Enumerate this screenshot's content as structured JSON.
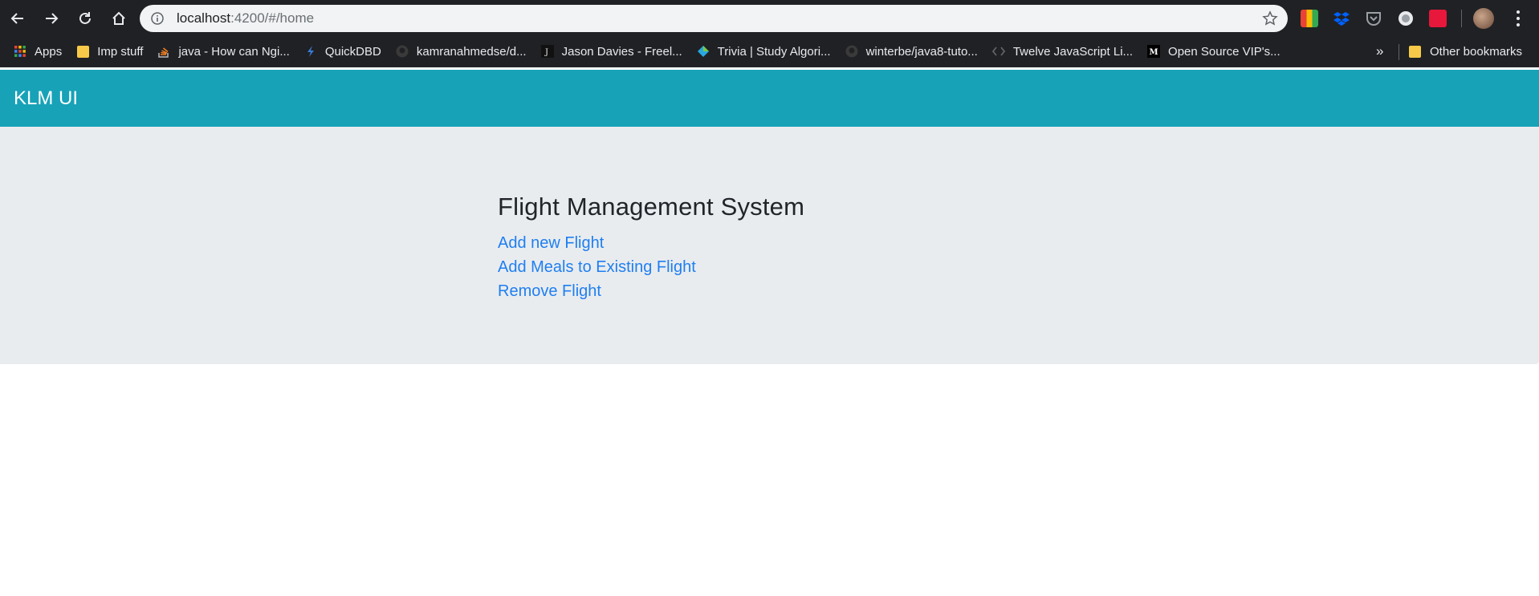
{
  "browser": {
    "url_host": "localhost",
    "url_path": ":4200/#/home"
  },
  "bookmarks": [
    {
      "label": "Apps",
      "icon": "apps-grid-icon"
    },
    {
      "label": "Imp stuff",
      "icon": "folder-icon"
    },
    {
      "label": "java - How can Ngi...",
      "icon": "stackoverflow-icon"
    },
    {
      "label": "QuickDBD",
      "icon": "quickdbd-icon"
    },
    {
      "label": "kamranahmedse/d...",
      "icon": "github-icon"
    },
    {
      "label": "Jason Davies - Freel...",
      "icon": "jd-icon"
    },
    {
      "label": "Trivia | Study Algori...",
      "icon": "trivia-icon"
    },
    {
      "label": "winterbe/java8-tuto...",
      "icon": "github-icon"
    },
    {
      "label": "Twelve JavaScript Li...",
      "icon": "js-icon"
    },
    {
      "label": "Open Source VIP's...",
      "icon": "medium-icon"
    }
  ],
  "bookmarks_more": "»",
  "other_bookmarks": "Other bookmarks",
  "app": {
    "brand": "KLM UI",
    "title": "Flight Management System",
    "links": [
      "Add new Flight",
      "Add Meals to Existing Flight",
      "Remove Flight"
    ]
  }
}
